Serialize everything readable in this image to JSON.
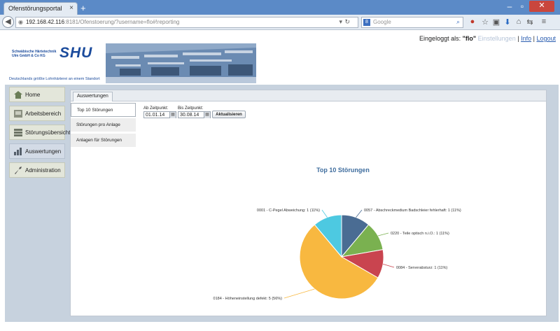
{
  "browser": {
    "tab_title": "Ofenstörungsportal",
    "tab_close": "×",
    "new_tab": "+",
    "url_host": "192.168.42.116",
    "url_rest": ":8181/Ofenstoerung/?username=flo#!reporting",
    "search_placeholder": "Google",
    "search_engine": "8",
    "window_close": "✕"
  },
  "header": {
    "logged_in_label": "Eingeloggt als:",
    "username": "\"flo\"",
    "links": [
      "Einstellungen",
      "Info",
      "Logout"
    ],
    "link_sep": "|",
    "logo_company": "Schwäbische Härtetechnik Ulm GmbH & Co KG",
    "logo_mark": "SHU",
    "tagline": "Deutschlands größte Lohnhärterei an einem Standort"
  },
  "sidebar": {
    "items": [
      {
        "label": "Home",
        "icon": "house-icon"
      },
      {
        "label": "Arbeitsbereich",
        "icon": "workspace-icon"
      },
      {
        "label": "Störungsübersicht",
        "icon": "stack-icon"
      },
      {
        "label": "Auswertungen",
        "icon": "bar-chart-icon"
      },
      {
        "label": "Administration",
        "icon": "wrench-icon"
      }
    ],
    "active": "Auswertungen"
  },
  "content": {
    "tab_label": "Auswertungen",
    "submenu": [
      "Top 10 Störungen",
      "Störungen pro Anlage",
      "Anlagen für Störungen"
    ],
    "from_label": "Ab Zeitpunkt:",
    "from_value": "01.01.14",
    "to_label": "Bis Zeitpunkt:",
    "to_value": "30.08.14",
    "update_button": "Aktualisieren"
  },
  "colors": {
    "accent": "#2f5f9a",
    "chart_title": "#3f6d9e"
  },
  "chart_data": {
    "type": "pie",
    "title": "Top 10 Störungen",
    "slices": [
      {
        "label": "0057 - Abschreckmedium Badschleier fehlerhaft: 1 (11%)",
        "value": 1,
        "percent": 11,
        "color": "#4a6c93"
      },
      {
        "label": "0220 - Teile optisch n.i.O.: 1 (11%)",
        "value": 1,
        "percent": 11,
        "color": "#7ab150"
      },
      {
        "label": "0084 - Serverabsturz: 1 (11%)",
        "value": 1,
        "percent": 11,
        "color": "#c9444f"
      },
      {
        "label": "0184 - Höheneinstellung defekt: 5 (56%)",
        "value": 5,
        "percent": 56,
        "color": "#f8b840"
      },
      {
        "label": "0001 - C-Pegel Abweichung: 1 (11%)",
        "value": 1,
        "percent": 11,
        "color": "#4dc9e1"
      }
    ]
  }
}
